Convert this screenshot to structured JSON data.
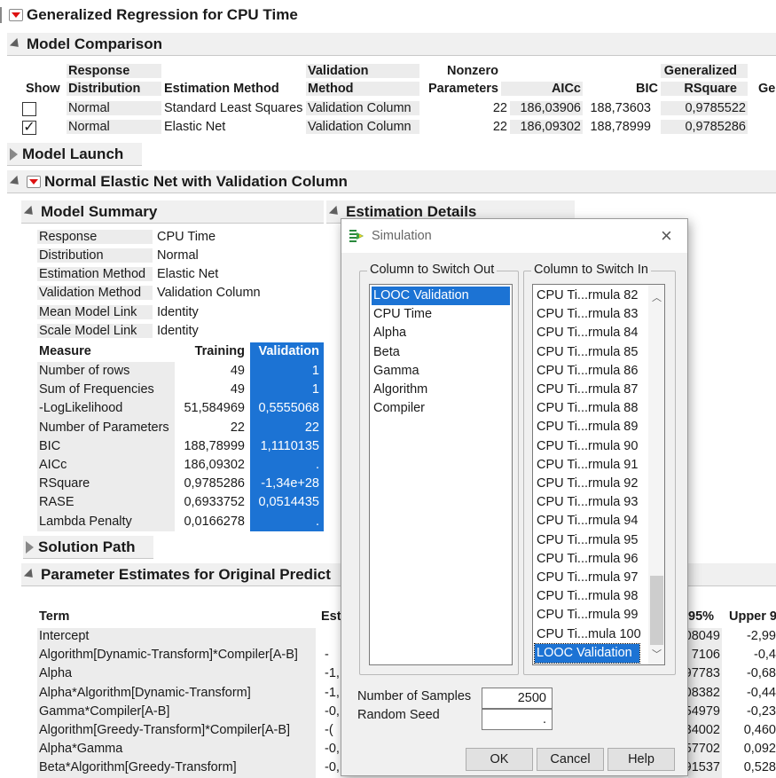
{
  "report": {
    "title": "Generalized Regression for CPU Time",
    "model_comparison": {
      "title": "Model Comparison",
      "headers": {
        "show": "Show",
        "resp1": "Response",
        "resp2": "Distribution",
        "est": "Estimation Method",
        "val1": "Validation",
        "val2": "Method",
        "nz1": "Nonzero",
        "nz2": "Parameters",
        "aicc": "AICc",
        "bic": "BIC",
        "gr1": "Generalized",
        "gr2": "RSquare",
        "ge": "Ge"
      },
      "rows": [
        {
          "checked": false,
          "dist": "Normal",
          "method": "Standard Least Squares",
          "validation": "Validation Column",
          "nonzero": "22",
          "aicc": "186,03906",
          "bic": "188,73603",
          "rsq": "0,9785522"
        },
        {
          "checked": true,
          "dist": "Normal",
          "method": "Elastic Net",
          "validation": "Validation Column",
          "nonzero": "22",
          "aicc": "186,09302",
          "bic": "188,78999",
          "rsq": "0,9785286"
        }
      ]
    },
    "model_launch": "Model Launch",
    "elastic_title": "Normal Elastic Net with Validation Column",
    "model_summary": {
      "title": "Model Summary",
      "info": [
        {
          "k": "Response",
          "v": "CPU Time"
        },
        {
          "k": "Distribution",
          "v": "Normal"
        },
        {
          "k": "Estimation Method",
          "v": "Elastic Net"
        },
        {
          "k": "Validation Method",
          "v": "Validation Column"
        },
        {
          "k": "Mean Model Link",
          "v": "Identity"
        },
        {
          "k": "Scale Model Link",
          "v": "Identity"
        }
      ],
      "measure_headers": {
        "measure": "Measure",
        "training": "Training",
        "validation": "Validation"
      },
      "measures": [
        {
          "m": "Number of rows",
          "t": "49",
          "v": "1"
        },
        {
          "m": "Sum of Frequencies",
          "t": "49",
          "v": "1"
        },
        {
          "m": "-LogLikelihood",
          "t": "51,584969",
          "v": "0,5555068"
        },
        {
          "m": "Number of Parameters",
          "t": "22",
          "v": "22"
        },
        {
          "m": "BIC",
          "t": "188,78999",
          "v": "1,1110135"
        },
        {
          "m": "AICc",
          "t": "186,09302",
          "v": "."
        },
        {
          "m": "RSquare",
          "t": "0,9785286",
          "v": "-1,34e+28"
        },
        {
          "m": "RASE",
          "t": "0,6933752",
          "v": "0,0514435"
        },
        {
          "m": "Lambda Penalty",
          "t": "0,0166278",
          "v": "."
        }
      ]
    },
    "estimation_details": "Estimation Details",
    "solution_path": "Solution Path",
    "param_estimates": {
      "title": "Parameter Estimates for Original Predict",
      "headers": {
        "term": "Term",
        "est": "Est",
        "lower": "95%",
        "upper": "Upper 9"
      },
      "rows": [
        {
          "term": "Intercept",
          "est": "",
          "lower": "08049",
          "upper": "-2,99"
        },
        {
          "term": "Algorithm[Dynamic-Transform]*Compiler[A-B]",
          "est": "-",
          "lower": "7106",
          "upper": "-0,4"
        },
        {
          "term": "Alpha",
          "est": "-1,",
          "lower": "97783",
          "upper": "-0,68"
        },
        {
          "term": "Alpha*Algorithm[Dynamic-Transform]",
          "est": "-1,",
          "lower": "08382",
          "upper": "-0,44"
        },
        {
          "term": "Gamma*Compiler[A-B]",
          "est": "-0,",
          "lower": "54979",
          "upper": "-0,23"
        },
        {
          "term": "Algorithm[Greedy-Transform]*Compiler[A-B]",
          "est": "-(",
          "lower": "34002",
          "upper": "0,460"
        },
        {
          "term": "Alpha*Gamma",
          "est": "-0,",
          "lower": "57702",
          "upper": "0,092"
        },
        {
          "term": "Beta*Algorithm[Greedy-Transform]",
          "est": "-0,",
          "lower": "91537",
          "upper": "0,528"
        }
      ]
    }
  },
  "dialog": {
    "title": "Simulation",
    "switch_out_label": "Column to Switch Out",
    "switch_in_label": "Column to Switch In",
    "switch_out_items": [
      "LOOC Validation",
      "CPU Time",
      "Alpha",
      "Beta",
      "Gamma",
      "Algorithm",
      "Compiler"
    ],
    "switch_out_selected": 0,
    "switch_in_items": [
      "CPU Ti...rmula 82",
      "CPU Ti...rmula 83",
      "CPU Ti...rmula 84",
      "CPU Ti...rmula 85",
      "CPU Ti...rmula 86",
      "CPU Ti...rmula 87",
      "CPU Ti...rmula 88",
      "CPU Ti...rmula 89",
      "CPU Ti...rmula 90",
      "CPU Ti...rmula 91",
      "CPU Ti...rmula 92",
      "CPU Ti...rmula 93",
      "CPU Ti...rmula 94",
      "CPU Ti...rmula 95",
      "CPU Ti...rmula 96",
      "CPU Ti...rmula 97",
      "CPU Ti...rmula 98",
      "CPU Ti...rmula 99",
      "CPU Ti...mula 100",
      "LOOC Validation"
    ],
    "switch_in_selected": 19,
    "num_samples_label": "Number of Samples",
    "num_samples_value": "2500",
    "random_seed_label": "Random Seed",
    "random_seed_value": ".",
    "ok": "OK",
    "cancel": "Cancel",
    "help": "Help"
  },
  "colors": {
    "accent": "#1c73d4",
    "header_bg": "#f0f0f0",
    "cell_bg": "#ececec",
    "red_arrow": "#dd1111"
  }
}
